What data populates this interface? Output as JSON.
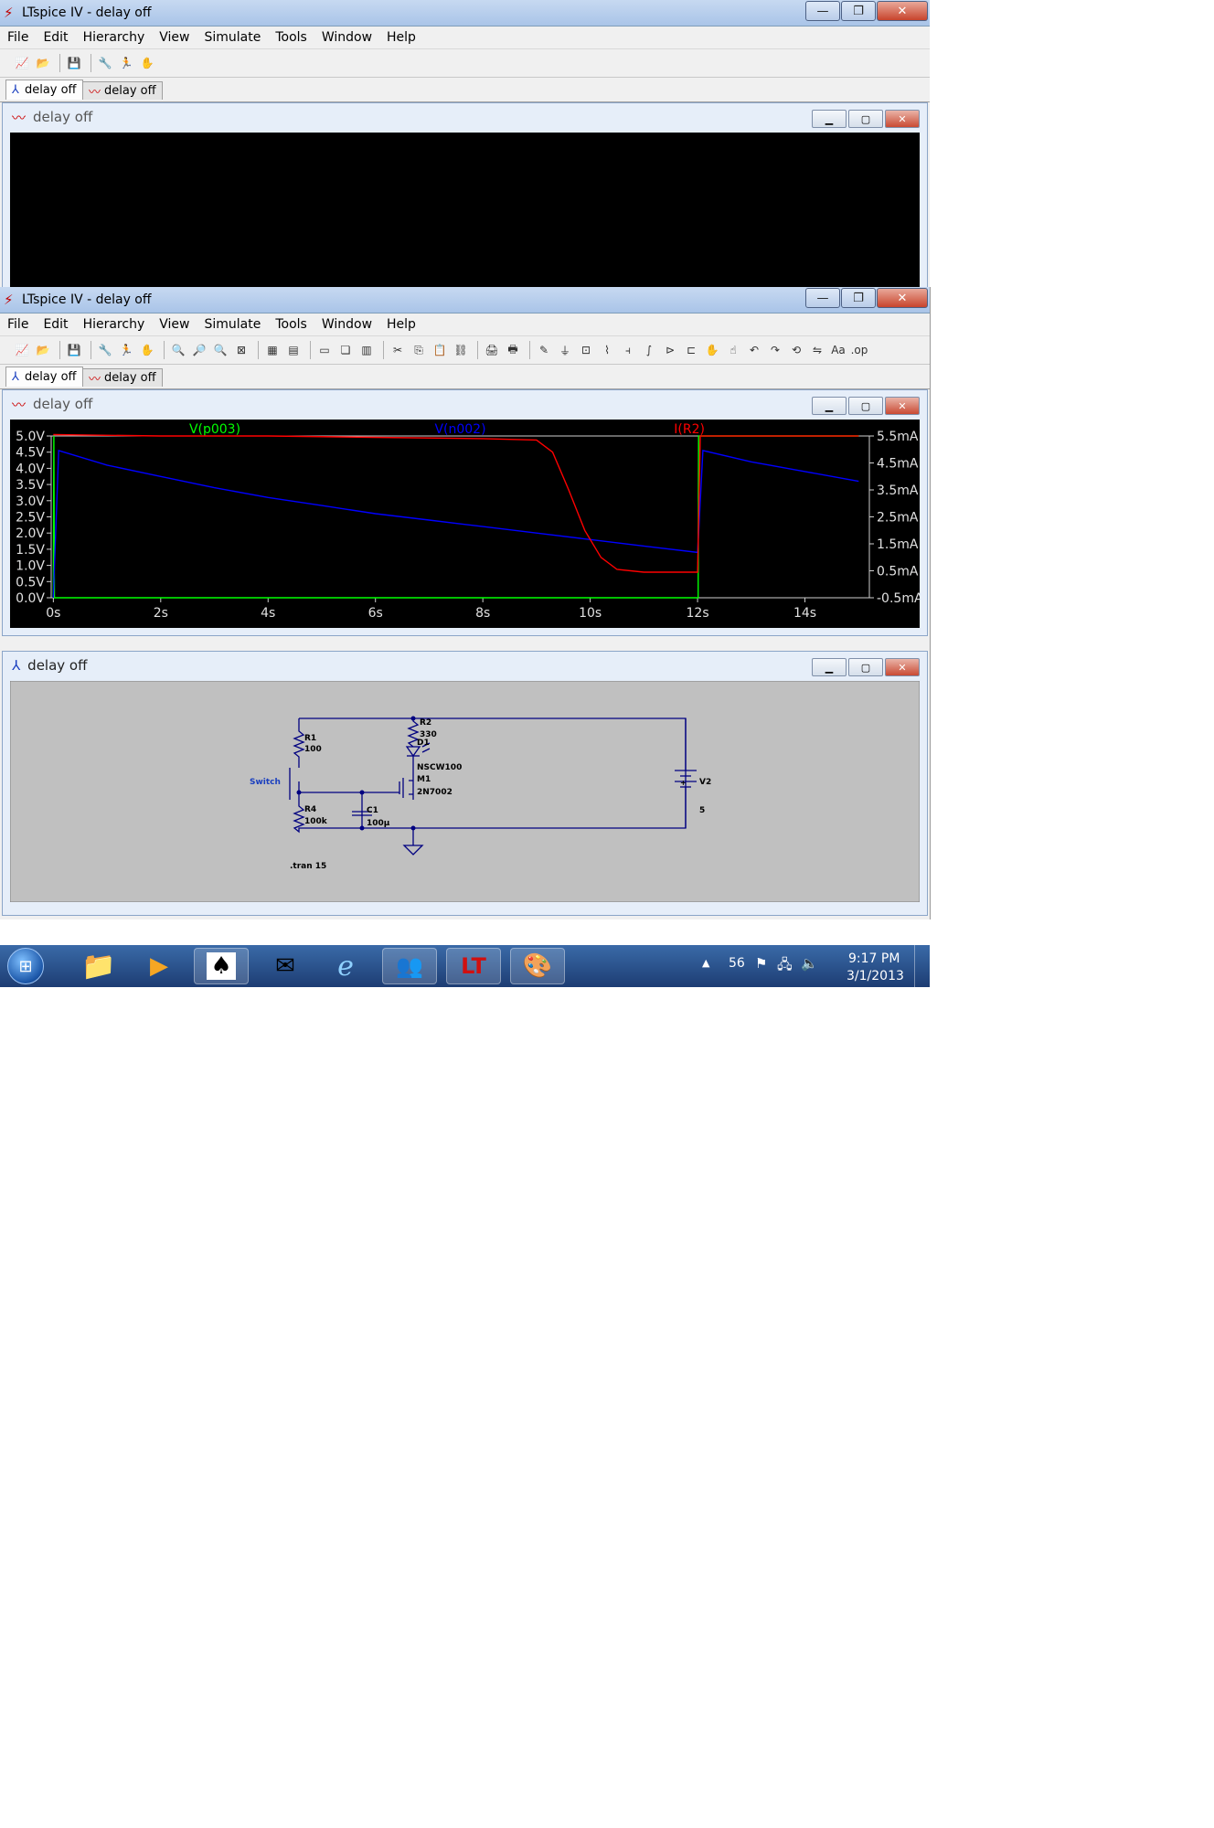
{
  "window_title": "LTspice IV - delay off",
  "menu": [
    "File",
    "Edit",
    "Hierarchy",
    "View",
    "Simulate",
    "Tools",
    "Window",
    "Help"
  ],
  "tabs": [
    {
      "label": "delay off",
      "type": "schematic"
    },
    {
      "label": "delay off",
      "type": "waveform"
    }
  ],
  "waveform_window": {
    "title": "delay off"
  },
  "schematic_window": {
    "title": "delay off"
  },
  "chart_data": {
    "type": "line",
    "series": [
      {
        "name": "V(p003)",
        "color": "#00ff00",
        "axis": "left",
        "x": [
          0,
          0.01,
          0.02,
          12,
          12.01,
          12.02,
          15
        ],
        "y": [
          0,
          5,
          0,
          0,
          0,
          5,
          5
        ]
      },
      {
        "name": "V(n002)",
        "color": "#0000ff",
        "axis": "left",
        "x": [
          0,
          0.1,
          1,
          2,
          3,
          4,
          5,
          6,
          7,
          8,
          9,
          10,
          11,
          12,
          12.1,
          13,
          14,
          15
        ],
        "y": [
          0,
          4.55,
          4.1,
          3.75,
          3.4,
          3.1,
          2.85,
          2.6,
          2.4,
          2.2,
          2.0,
          1.8,
          1.6,
          1.4,
          4.55,
          4.2,
          3.9,
          3.6
        ]
      },
      {
        "name": "I(R2)",
        "color": "#ff0000",
        "axis": "right",
        "unit": "mA",
        "x": [
          0,
          2,
          4,
          6,
          8,
          9,
          9.3,
          9.6,
          9.9,
          10.2,
          10.5,
          11,
          12,
          12.05,
          15
        ],
        "y": [
          5.55,
          5.5,
          5.5,
          5.45,
          5.4,
          5.35,
          4.9,
          3.5,
          2.0,
          1.0,
          0.55,
          0.45,
          0.45,
          5.5,
          5.5
        ]
      }
    ],
    "x_ticks": [
      "0s",
      "2s",
      "4s",
      "6s",
      "8s",
      "10s",
      "12s",
      "14s"
    ],
    "x_range": [
      -0.04,
      15.2
    ],
    "y_left_ticks": [
      "5.0V",
      "4.5V",
      "4.0V",
      "3.5V",
      "3.0V",
      "2.5V",
      "2.0V",
      "1.5V",
      "1.0V",
      "0.5V",
      "0.0V"
    ],
    "y_left_range": [
      0,
      5
    ],
    "y_right_ticks": [
      "5.5mA",
      "4.5mA",
      "3.5mA",
      "2.5mA",
      "1.5mA",
      "0.5mA",
      "-0.5mA"
    ],
    "y_right_range": [
      -0.5,
      5.5
    ],
    "cursor_x": 12,
    "grid": false
  },
  "schematic": {
    "labels": {
      "r1": "R1",
      "r1_val": "100",
      "r2": "R2",
      "r2_val": "330",
      "d1": "D1",
      "d1_val": "NSCW100",
      "m1": "M1",
      "m1_val": "2N7002",
      "r4": "R4",
      "r4_val": "100k",
      "c1": "C1",
      "c1_val": "100µ",
      "v2": "V2",
      "v2_val": "5",
      "switch": "Switch",
      "directive": ".tran 15",
      "plus": "+"
    }
  },
  "taskbar": {
    "time": "9:17 PM",
    "date": "3/1/2013",
    "badge": "56"
  }
}
